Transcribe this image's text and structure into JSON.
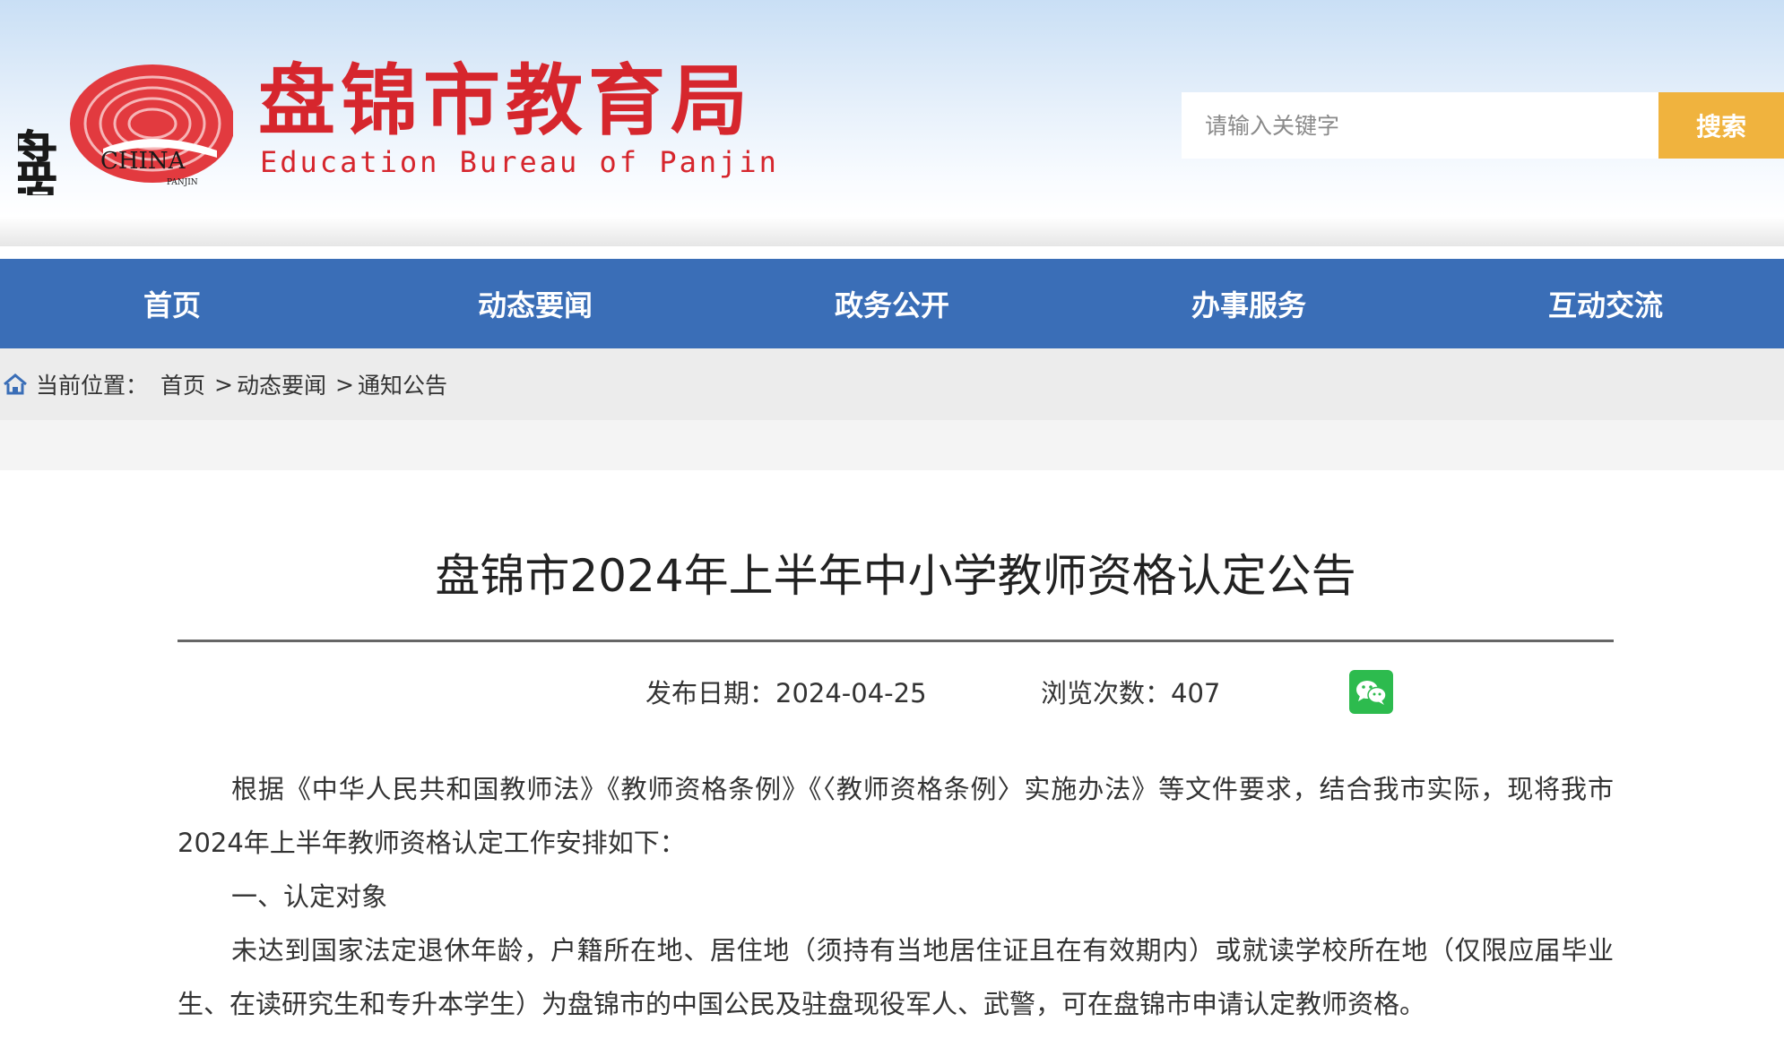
{
  "header": {
    "logo_text_cn": "盘锦",
    "logo_text_en": "CHINA",
    "logo_text_small": "PANJIN",
    "site_title": "盘锦市教育局",
    "site_subtitle": "Education Bureau of Panjin",
    "search_placeholder": "请输入关键字",
    "search_button": "搜索"
  },
  "nav": {
    "items": [
      {
        "label": "首页"
      },
      {
        "label": "动态要闻"
      },
      {
        "label": "政务公开"
      },
      {
        "label": "办事服务"
      },
      {
        "label": "互动交流"
      }
    ]
  },
  "breadcrumb": {
    "prefix": "当前位置：",
    "items": [
      "首页",
      "动态要闻",
      "通知公告"
    ],
    "separator": ">"
  },
  "article": {
    "title": "盘锦市2024年上半年中小学教师资格认定公告",
    "date_label": "发布日期：2024-04-25",
    "views_label": "浏览次数：407",
    "paragraphs": [
      "根据《中华人民共和国教师法》《教师资格条例》《〈教师资格条例〉实施办法》等文件要求，结合我市实际，现将我市2024年上半年教师资格认定工作安排如下：",
      "一、认定对象",
      "未达到国家法定退休年龄，户籍所在地、居住地（须持有当地居住证且在有效期内）或就读学校所在地（仅限应届毕业生、在读研究生和专升本学生）为盘锦市的中国公民及驻盘现役军人、武警，可在盘锦市申请认定教师资格。"
    ]
  },
  "colors": {
    "brand_red": "#d6262d",
    "nav_blue": "#3a6eb7",
    "search_orange": "#f0b33e",
    "wechat_green": "#2dbb4e"
  },
  "icons": [
    "panjin-logo-icon",
    "home-icon",
    "wechat-icon"
  ]
}
